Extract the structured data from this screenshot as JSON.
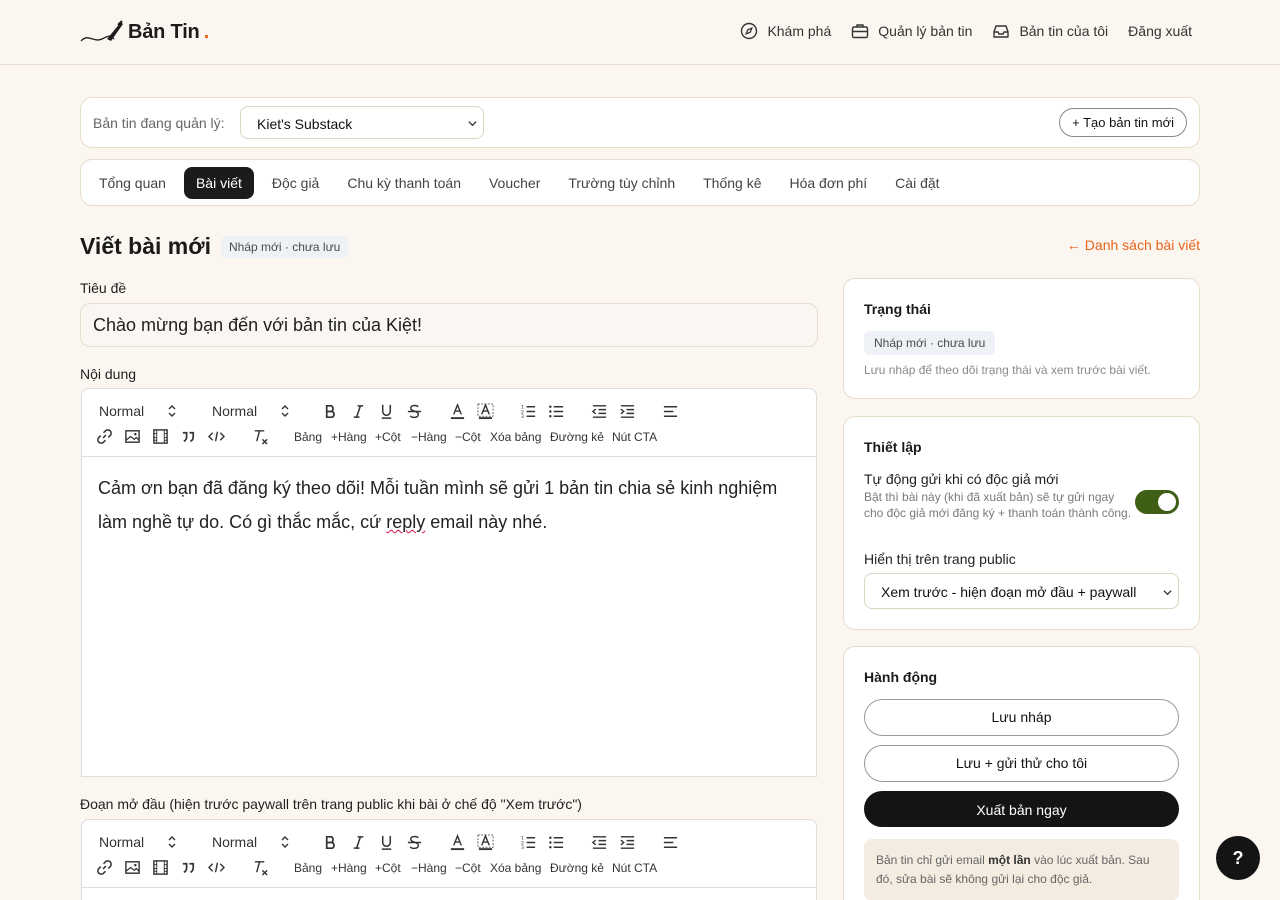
{
  "brand": {
    "name": "Bản Tin",
    "dot": "."
  },
  "nav": {
    "discover": "Khám phá",
    "manage": "Quản lý bản tin",
    "my_newsletters": "Bản tin của tôi",
    "logout": "Đăng xuất"
  },
  "selector": {
    "label": "Bản tin đang quản lý:",
    "value": "Kiet's Substack",
    "create_label": "+ Tạo bản tin mới"
  },
  "tabs": [
    "Tổng quan",
    "Bài viết",
    "Độc giả",
    "Chu kỳ thanh toán",
    "Voucher",
    "Trường tùy chỉnh",
    "Thống kê",
    "Hóa đơn phí",
    "Cài đặt"
  ],
  "active_tab": "Bài viết",
  "page": {
    "title": "Viết bài mới",
    "status": "Nháp mới · chưa lưu",
    "back_link": "← Danh sách bài viết"
  },
  "form": {
    "title_label": "Tiêu đề",
    "title_value": "Chào mừng bạn đến với bản tin của Kiệt!",
    "content_label": "Nội dung",
    "content_text_before": "Cảm ơn bạn đã đăng ký theo dõi! Mỗi tuần mình sẽ gửi 1 bản tin chia sẻ kinh nghiệm làm nghề tự do. Có gì thắc mắc, cứ ",
    "content_text_spell": "reply",
    "content_text_after": " email này nhé.",
    "intro_label": "Đoạn mở đầu (hiện trước paywall trên trang public khi bài ở chế độ \"Xem trước\")"
  },
  "toolbar": {
    "heading_select": "Normal",
    "size_select": "Normal",
    "table": "Bảng",
    "add_row": "+Hàng",
    "add_col": "+Cột",
    "del_row": "−Hàng",
    "del_col": "−Cột",
    "del_table": "Xóa bảng",
    "hr": "Đường kẻ",
    "cta": "Nút CTA"
  },
  "sidebar": {
    "status_title": "Trạng thái",
    "status_pill": "Nháp mới · chưa lưu",
    "status_hint": "Lưu nháp để theo dõi trạng thái và xem trước bài viết.",
    "settings_title": "Thiết lập",
    "autosend_label": "Tự động gửi khi có độc giả mới",
    "autosend_hint": "Bật thì bài này (khi đã xuất bản) sẽ tự gửi ngay cho độc giả mới đăng ký + thanh toán thành công.",
    "autosend_on": true,
    "public_label": "Hiển thị trên trang public",
    "public_value": "Xem trước - hiện đoạn mở đầu + paywall",
    "actions_title": "Hành động",
    "save_draft": "Lưu nháp",
    "save_test": "Lưu + gửi thử cho tôi",
    "publish": "Xuất bản ngay",
    "note_before": "Bản tin chỉ gửi email ",
    "note_bold": "một lần",
    "note_after": " vào lúc xuất bản. Sau đó, sửa bài sẽ không gửi lại cho độc giả."
  },
  "help": "?",
  "colors": {
    "accent": "#e8621c",
    "toggle_on": "#3f5e16",
    "primary": "#141414",
    "background": "#fbf7f0"
  }
}
